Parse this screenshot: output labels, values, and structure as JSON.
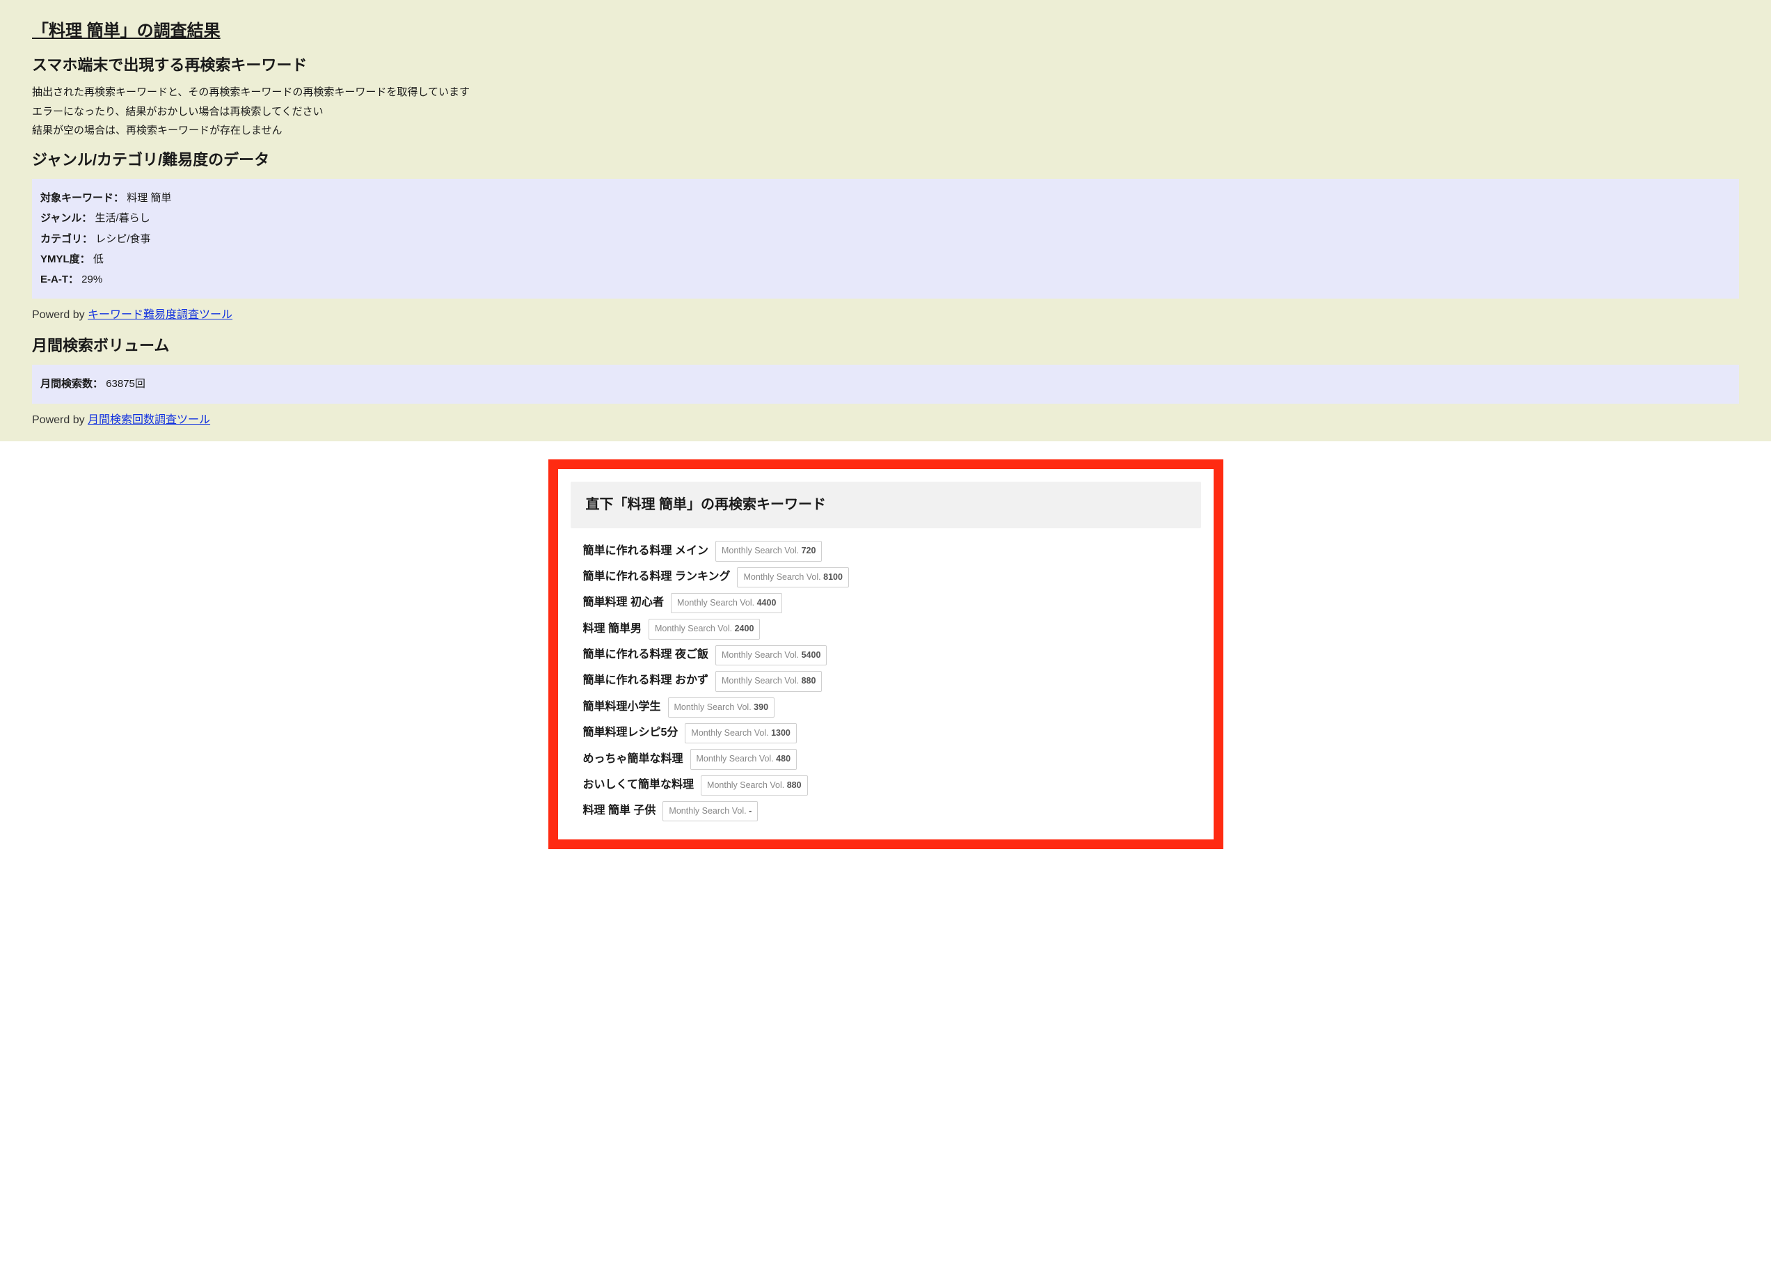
{
  "main_title": "「料理 簡単」の調査結果",
  "section_sp_header": "スマホ端末で出現する再検索キーワード",
  "sp_notes": [
    "抽出された再検索キーワードと、その再検索キーワードの再検索キーワードを取得しています",
    "エラーになったり、結果がおかしい場合は再検索してください",
    "結果が空の場合は、再検索キーワードが存在しません"
  ],
  "section_genre_header": "ジャンル/カテゴリ/難易度のデータ",
  "genre_rows": {
    "keyword_label": "対象キーワード：",
    "keyword_value": "料理 簡単",
    "genre_label": "ジャンル：",
    "genre_value": "生活/暮らし",
    "category_label": "カテゴリ：",
    "category_value": "レシピ/食事",
    "ymyl_label": "YMYL度：",
    "ymyl_value": "低",
    "eat_label": "E-A-T：",
    "eat_value": "29%"
  },
  "powered_prefix": "Powerd by ",
  "powered_genre_link": "キーワード難易度調査ツール",
  "section_volume_header": "月間検索ボリューム",
  "volume_label": "月間検索数：",
  "volume_value": "63875回",
  "powered_volume_link": "月間検索回数調査ツール",
  "direct_header": "直下「料理 簡単」の再検索キーワード",
  "vol_prefix": "Monthly Search Vol. ",
  "keywords": [
    {
      "term": "簡単に作れる料理 メイン",
      "vol": "720"
    },
    {
      "term": "簡単に作れる料理 ランキング",
      "vol": "8100"
    },
    {
      "term": "簡単料理 初心者",
      "vol": "4400"
    },
    {
      "term": "料理 簡単男",
      "vol": "2400"
    },
    {
      "term": "簡単に作れる料理 夜ご飯",
      "vol": "5400"
    },
    {
      "term": "簡単に作れる料理 おかず",
      "vol": "880"
    },
    {
      "term": "簡単料理小学生",
      "vol": "390"
    },
    {
      "term": "簡単料理レシピ5分",
      "vol": "1300"
    },
    {
      "term": "めっちゃ簡単な料理",
      "vol": "480"
    },
    {
      "term": "おいしくて簡単な料理",
      "vol": "880"
    },
    {
      "term": "料理 簡単 子供",
      "vol": "-"
    }
  ]
}
